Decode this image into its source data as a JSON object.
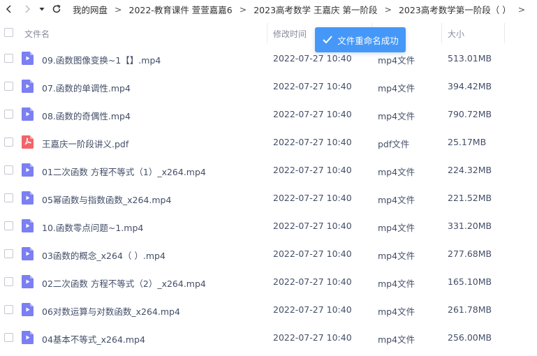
{
  "breadcrumb": [
    "我的网盘",
    "2022-教育课件 萱萱嘉嘉6",
    "2023高考数学 王嘉庆 第一阶段",
    "2023高考数学第一阶段（ ）"
  ],
  "breadcrumb_separator": ">",
  "header": {
    "name": "文件名",
    "time": "修改时间",
    "size": "大小"
  },
  "toast": {
    "text": "文件重命名成功",
    "color": "#4598f7"
  },
  "files": [
    {
      "name": "09.函数图像变换~1【】.mp4",
      "time": "2022-07-27 10:40",
      "type": "mp4文件",
      "size": "513.01MB",
      "icon": "video-file-icon"
    },
    {
      "name": "07.函数的单调性.mp4",
      "time": "2022-07-27 10:40",
      "type": "mp4文件",
      "size": "394.42MB",
      "icon": "video-file-icon"
    },
    {
      "name": "08.函数的奇偶性.mp4",
      "time": "2022-07-27 10:40",
      "type": "mp4文件",
      "size": "790.72MB",
      "icon": "video-file-icon"
    },
    {
      "name": "王嘉庆一阶段讲义.pdf",
      "time": "2022-07-27 10:40",
      "type": "pdf文件",
      "size": "25.17MB",
      "icon": "pdf-file-icon"
    },
    {
      "name": "01二次函数 方程不等式（1）_x264.mp4",
      "time": "2022-07-27 10:40",
      "type": "mp4文件",
      "size": "224.32MB",
      "icon": "video-file-icon"
    },
    {
      "name": "05幂函数与指数函数_x264.mp4",
      "time": "2022-07-27 10:40",
      "type": "mp4文件",
      "size": "221.52MB",
      "icon": "video-file-icon"
    },
    {
      "name": "10.函数零点问题~1.mp4",
      "time": "2022-07-27 10:40",
      "type": "mp4文件",
      "size": "331.20MB",
      "icon": "video-file-icon"
    },
    {
      "name": "03函数的概念_x264（ ）.mp4",
      "time": "2022-07-27 10:40",
      "type": "mp4文件",
      "size": "277.68MB",
      "icon": "video-file-icon"
    },
    {
      "name": "02二次函数 方程不等式（2）_x264.mp4",
      "time": "2022-07-27 10:40",
      "type": "mp4文件",
      "size": "165.10MB",
      "icon": "video-file-icon"
    },
    {
      "name": "06对数运算与对数函数_x264.mp4",
      "time": "2022-07-27 10:40",
      "type": "mp4文件",
      "size": "261.78MB",
      "icon": "video-file-icon"
    },
    {
      "name": "04基本不等式_x264.mp4",
      "time": "2022-07-27 10:40",
      "type": "mp4文件",
      "size": "256.00MB",
      "icon": "video-file-icon"
    }
  ],
  "colors": {
    "video_icon": "#7b7ff2",
    "pdf_icon": "#f2646a",
    "accent": "#4598f7"
  }
}
